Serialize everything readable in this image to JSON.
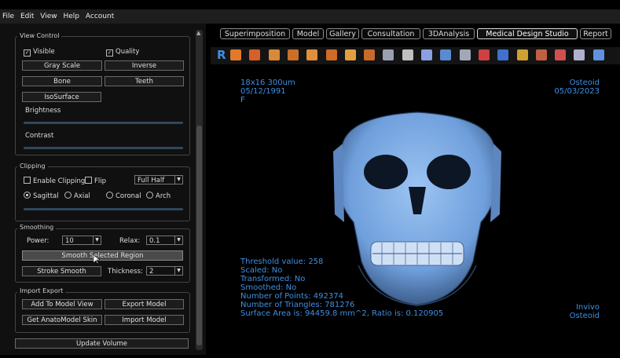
{
  "menu": {
    "file": "File",
    "edit": "Edit",
    "view": "View",
    "help": "Help",
    "account": "Account"
  },
  "left": {
    "view_control": {
      "title": "View Control",
      "visible": "Visible",
      "quality": "Quality",
      "gray_scale": "Gray Scale",
      "inverse": "Inverse",
      "bone": "Bone",
      "teeth": "Teeth",
      "isosurface": "IsoSurface",
      "brightness": "Brightness",
      "contrast": "Contrast"
    },
    "clipping": {
      "title": "Clipping",
      "enable": "Enable Clipping",
      "flip": "Flip",
      "half_value": "Full Half",
      "sagittal": "Sagittal",
      "axial": "Axial",
      "coronal": "Coronal",
      "arch": "Arch"
    },
    "smoothing": {
      "title": "Smoothing",
      "power_label": "Power:",
      "power_value": "10",
      "relax_label": "Relax:",
      "relax_value": "0.1",
      "smooth_selected": "Smooth Selected Region",
      "stroke_smooth": "Stroke Smooth",
      "thickness_label": "Thickness:",
      "thickness_value": "2"
    },
    "import_export": {
      "title": "Import Export",
      "add_to_model": "Add To Model View",
      "export_model": "Export Model",
      "get_anato": "Get AnatoModel Skin",
      "import_model": "Import Model"
    },
    "update_volume": "Update Volume"
  },
  "tabs": [
    "Superimposition",
    "Model",
    "Gallery",
    "Consultation",
    "3DAnalysis",
    "Medical Design Studio",
    "Report"
  ],
  "toolbar": {
    "r_label": "R",
    "icon_colors": [
      "#e07a2a",
      "#d4602a",
      "#d88a3a",
      "#c8702a",
      "#e0903a",
      "#d06a28",
      "#e0a040",
      "#c86a2a",
      "#9aa0b0",
      "#c0c0c0",
      "#8aa0e0",
      "#5a8ad0",
      "#a0a8b8",
      "#d04040",
      "#4070d0",
      "#d0a030",
      "#c06040",
      "#d05050",
      "#b0b0d0",
      "#6090e0"
    ]
  },
  "viewport": {
    "top_left": [
      "18x16 300um",
      "05/12/1991",
      "F"
    ],
    "top_right": [
      "Osteoid",
      "05/03/2023"
    ],
    "bottom_left": [
      "Threshold value: 258",
      "Scaled: No",
      "Transformed: No",
      "Smoothed: No",
      "Number of Points: 492374",
      "Number of Triangles: 781276",
      "Surface Area is: 94459.8 mm^2, Ratio is: 0.120905"
    ],
    "bottom_right": [
      "Invivo",
      "Osteoid"
    ],
    "overlay_color": "#3f8fe2"
  }
}
